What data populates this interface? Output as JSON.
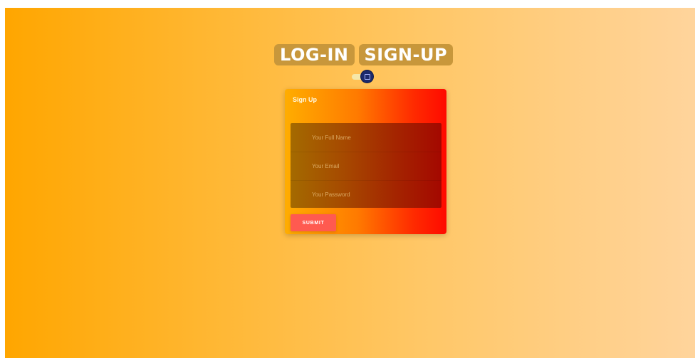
{
  "tabs": [
    {
      "label": "LOG-IN"
    },
    {
      "label": "SIGN-UP"
    }
  ],
  "toggle": {
    "icon": "square-icon"
  },
  "form": {
    "title": "Sign Up",
    "fields": {
      "full_name": {
        "placeholder": "Your Full Name",
        "value": ""
      },
      "email": {
        "placeholder": "Your Email",
        "value": ""
      },
      "password": {
        "placeholder": "Your Password",
        "value": ""
      }
    },
    "submit_label": "SUBMIT"
  },
  "colors": {
    "background_start": "#ffa600",
    "background_end": "#ffd49c",
    "card_start": "#ffad00",
    "card_end": "#ff0a00",
    "tab_bg": "#c8973b",
    "toggle_knob": "#1c2a6b",
    "submit_bg": "#ff5a50"
  }
}
